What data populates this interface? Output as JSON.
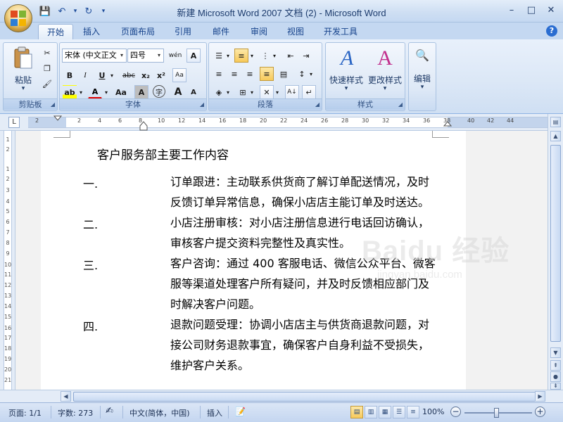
{
  "window": {
    "title": "新建 Microsoft Word 2007 文档 (2) - Microsoft Word",
    "controls": [
      "–",
      "□",
      "✕"
    ]
  },
  "qat": {
    "save": "💾",
    "undo": "↶",
    "undo_dd": "▾",
    "redo": "↻",
    "customize": "▾"
  },
  "tabs": [
    "开始",
    "插入",
    "页面布局",
    "引用",
    "邮件",
    "审阅",
    "视图",
    "开发工具"
  ],
  "help": "?",
  "ribbon": {
    "clipboard": {
      "label": "剪贴板",
      "paste": "粘贴",
      "paste_dd": "▾"
    },
    "font": {
      "label": "字体",
      "font_name": "宋体 (中文正文",
      "font_size": "四号",
      "phonetic": "wén",
      "border_char": "A",
      "bold": "B",
      "italic": "I",
      "underline": "U",
      "strike": "abc",
      "sub": "x₂",
      "sup": "x²",
      "clear": "Aa",
      "case": "Aa",
      "shade": "A",
      "enclose": "字",
      "grow": "A",
      "shrink": "A"
    },
    "paragraph": {
      "label": "段落"
    },
    "styles": {
      "label": "样式",
      "quick": "快速样式",
      "change": "更改样式"
    },
    "editing": {
      "label": "编辑"
    }
  },
  "ruler": {
    "corner": "L",
    "ticks": [
      "2",
      "2",
      "4",
      "6",
      "8",
      "10",
      "12",
      "14",
      "16",
      "18",
      "20",
      "22",
      "24",
      "26",
      "28",
      "30",
      "32",
      "34",
      "36",
      "38",
      "40",
      "42",
      "44"
    ],
    "vticks": [
      "1",
      "2",
      "1",
      "2",
      "3",
      "4",
      "5",
      "6",
      "7",
      "8",
      "9",
      "10",
      "11",
      "12",
      "13",
      "14",
      "15",
      "16",
      "17",
      "18",
      "19",
      "20",
      "21"
    ]
  },
  "document": {
    "title": "客户服务部主要工作内容",
    "items": [
      {
        "num": "一.",
        "lines": [
          "订单跟进：主动联系供货商了解订单配送情况，及时",
          "反馈订单异常信息，确保小店店主能订单及时送达。"
        ]
      },
      {
        "num": "二.",
        "lines": [
          "小店注册审核：对小店注册信息进行电话回访确认，",
          "审核客户提交资料完整性及真实性。"
        ]
      },
      {
        "num": "三.",
        "lines": [
          "客户咨询：通过 400 客服电话、微信公众平台、微客",
          "服等渠道处理客户所有疑问，并及时反馈相应部门及",
          "时解决客户问题。"
        ]
      },
      {
        "num": "四.",
        "lines": [
          "退款问题受理：协调小店店主与供货商退款问题，对",
          "接公司财务退款事宜，确保客户自身利益不受损失，",
          "维护客户关系。"
        ]
      }
    ]
  },
  "watermark": {
    "logo": "Baidu 经验",
    "url": "jingyan.baidu.com"
  },
  "statusbar": {
    "page": "页面: 1/1",
    "words": "字数: 273",
    "lang": "中文(简体，中国)",
    "mode": "插入",
    "zoom": "100%",
    "zoom_minus": "−",
    "zoom_plus": "+"
  }
}
